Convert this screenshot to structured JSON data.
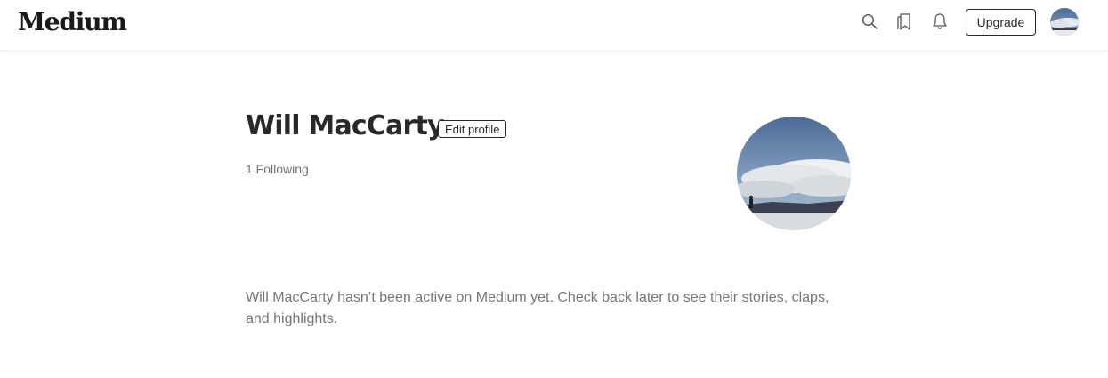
{
  "header": {
    "logo": "Medium",
    "icons": [
      "search-icon",
      "bookmarks-icon",
      "notifications-icon"
    ],
    "upgrade_label": "Upgrade"
  },
  "profile": {
    "name": "Will MacCarty",
    "edit_label": "Edit profile",
    "following": "1 Following",
    "inactive_message": "Will MacCarty hasn’t been active on Medium yet. Check back later to see their stories, claps, and highlights."
  },
  "colors": {
    "text_primary": "#292929",
    "text_secondary": "#757575",
    "background": "#ffffff"
  }
}
